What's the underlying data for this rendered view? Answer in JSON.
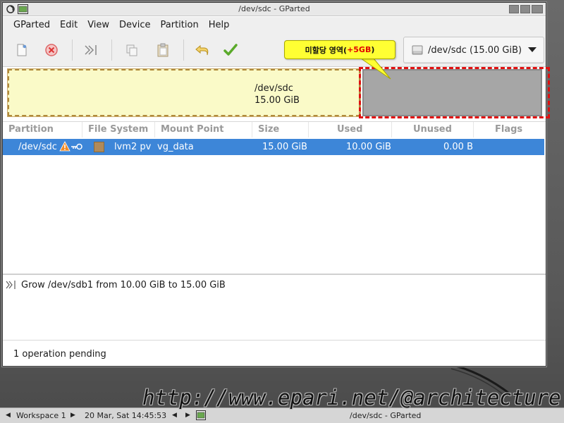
{
  "window": {
    "title": "/dev/sdc - GParted"
  },
  "menubar": {
    "items": [
      "GParted",
      "Edit",
      "View",
      "Device",
      "Partition",
      "Help"
    ]
  },
  "toolbar": {
    "buttons": [
      "new-icon",
      "delete-icon",
      "resize-move-icon",
      "copy-icon",
      "paste-icon",
      "undo-icon",
      "apply-icon"
    ],
    "device_select": {
      "value": "/dev/sdc (15.00 GiB)"
    }
  },
  "callout": {
    "text": "미할당 영역(",
    "highlight": "+5GB",
    "close": ")",
    "colors": {
      "background": "#ffff33",
      "highlight": "#e00000"
    }
  },
  "graph": {
    "partition": {
      "name": "/dev/sdc",
      "size": "15.00 GiB"
    },
    "colors": {
      "partition_bg": "#fafac8",
      "unallocated": "#a6a6a6",
      "marker": "#e01010"
    }
  },
  "table": {
    "headers": [
      "Partition",
      "File System",
      "Mount Point",
      "Size",
      "Used",
      "Unused",
      "Flags"
    ],
    "rows": [
      {
        "partition": "/dev/sdc",
        "filesystem": "lvm2 pv",
        "mountpoint": "vg_data",
        "size": "15.00 GiB",
        "used": "10.00 GiB",
        "unused": "0.00 B",
        "flags": ""
      }
    ],
    "selected_color": "#3d86d8"
  },
  "operations": {
    "items": [
      "Grow /dev/sdb1 from 10.00 GiB to 15.00 GiB"
    ]
  },
  "status": {
    "text": "1 operation pending"
  },
  "watermark": {
    "text": "http://www.epari.net/@architecture"
  },
  "taskbar": {
    "workspace": "Workspace 1",
    "datetime": "20 Mar, Sat 14:45:53",
    "task": "/dev/sdc - GParted"
  }
}
